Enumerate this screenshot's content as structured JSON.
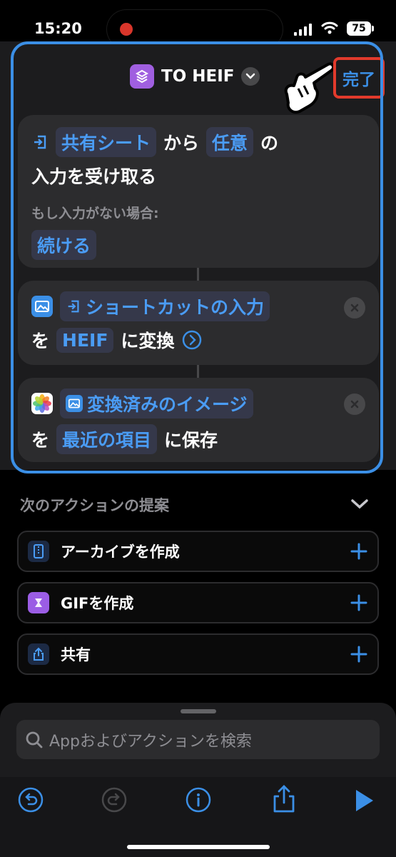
{
  "status": {
    "time": "15:20",
    "battery": "75"
  },
  "header": {
    "title": "TO HEIF",
    "done_label": "完了"
  },
  "action1": {
    "chip_source": "共有シート",
    "text_from": "から",
    "chip_type": "任意",
    "text_no": "の",
    "line2": "入力を受け取る",
    "if_empty": "もし入力がない場合:",
    "chip_continue": "続ける"
  },
  "action2": {
    "chip_input": "ショートカットの入力",
    "text_wo": "を",
    "chip_format": "HEIF",
    "text_convert": "に変換"
  },
  "action3": {
    "chip_image": "変換済みのイメージ",
    "text_wo": "を",
    "chip_album": "最近の項目",
    "text_save": "に保存"
  },
  "suggestions": {
    "header": "次のアクションの提案",
    "items": [
      {
        "label": "アーカイブを作成",
        "icon": "archive-icon"
      },
      {
        "label": "GIFを作成",
        "icon": "gif-icon"
      },
      {
        "label": "共有",
        "icon": "share-icon"
      }
    ]
  },
  "search": {
    "placeholder": "Appおよびアクションを検索"
  },
  "colors": {
    "accent": "#3b8fe6",
    "highlight": "#e23a2c",
    "background": "#000000",
    "card": "#2c2c2e"
  }
}
